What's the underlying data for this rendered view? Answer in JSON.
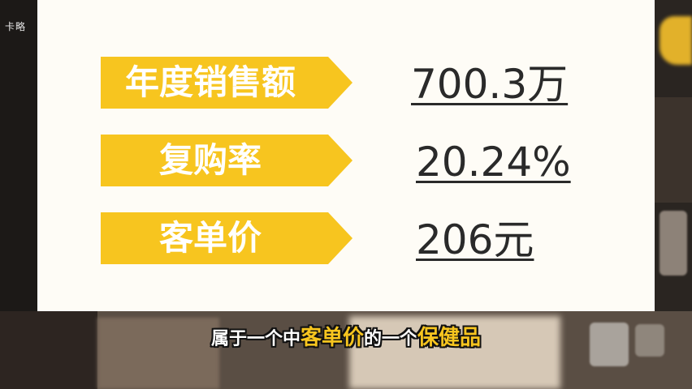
{
  "watermark": "卡略",
  "metrics": [
    {
      "label": "年度销售额",
      "value": "700.3万"
    },
    {
      "label": "复购率",
      "value": "20.24%"
    },
    {
      "label": "客单价",
      "value": "206元"
    }
  ],
  "subtitle": {
    "part1": "属于一个中",
    "highlight1": "客单价",
    "part2": "的一个",
    "highlight2": "保健品"
  },
  "colors": {
    "banner": "#f7c51f",
    "card": "#fefcf6",
    "value_text": "#2a2a2a",
    "subtitle_highlight": "#f7c51f"
  }
}
